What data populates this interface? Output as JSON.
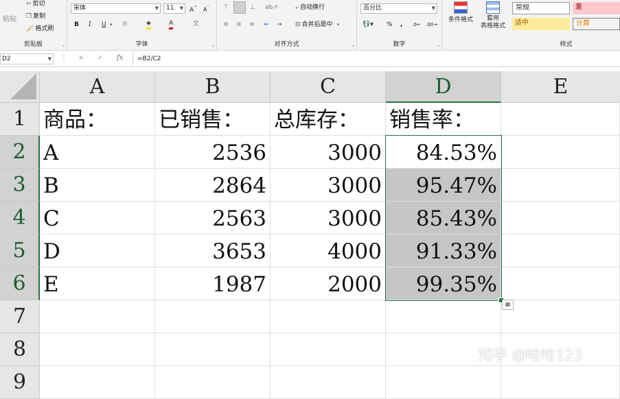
{
  "ribbon": {
    "clipboard": {
      "paste": "粘贴",
      "cut": "剪切",
      "copy": "复制",
      "format_painter": "格式刷",
      "label": "剪贴板"
    },
    "font": {
      "name": "宋体",
      "size": "11",
      "label": "字体",
      "bold": "B",
      "italic": "I",
      "underline": "U"
    },
    "alignment": {
      "wrap": "自动换行",
      "merge": "合并后居中",
      "label": "对齐方式"
    },
    "number": {
      "format": "百分比",
      "percent": "%",
      "comma": ",",
      "label": "数字"
    },
    "styles": {
      "conditional": "条件格式",
      "table_line1": "套用",
      "table_line2": "表格格式",
      "normal": "常规",
      "bad": "差",
      "neutral": "适中",
      "calc": "计算",
      "label": "样式"
    }
  },
  "formula_bar": {
    "name_box": "D2",
    "cancel": "×",
    "enter": "✓",
    "fx": "fx",
    "formula": "=B2/C2"
  },
  "columns": [
    "A",
    "B",
    "C",
    "D",
    "E"
  ],
  "rows": [
    {
      "num": "1",
      "a": "商品：",
      "b": "已销售：",
      "c": "总库存：",
      "d": "销售率："
    },
    {
      "num": "2",
      "a": "A",
      "b": "2536",
      "c": "3000",
      "d": "84.53%"
    },
    {
      "num": "3",
      "a": "B",
      "b": "2864",
      "c": "3000",
      "d": "95.47%"
    },
    {
      "num": "4",
      "a": "C",
      "b": "2563",
      "c": "3000",
      "d": "85.43%"
    },
    {
      "num": "5",
      "a": "D",
      "b": "3653",
      "c": "4000",
      "d": "91.33%"
    },
    {
      "num": "6",
      "a": "E",
      "b": "1987",
      "c": "2000",
      "d": "99.35%"
    },
    {
      "num": "7"
    },
    {
      "num": "8"
    },
    {
      "num": "9"
    }
  ],
  "watermark": "知乎 @哈哈123",
  "colors": {
    "accent": "#217346",
    "selection_fill": "#c6c6c6",
    "bad_fill": "#ffc7ce",
    "neutral_fill": "#ffeb9c"
  }
}
